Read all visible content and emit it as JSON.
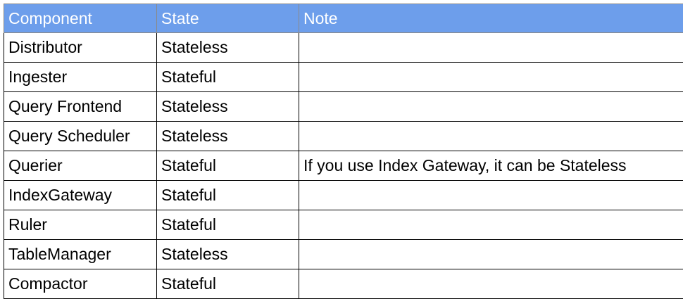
{
  "table": {
    "columns": [
      "Component",
      "State",
      "Note"
    ],
    "rows": [
      [
        "Distributor",
        "Stateless",
        ""
      ],
      [
        "Ingester",
        "Stateful",
        ""
      ],
      [
        "Query Frontend",
        "Stateless",
        ""
      ],
      [
        "Query Scheduler",
        "Stateless",
        ""
      ],
      [
        "Querier",
        "Stateful",
        "If you use Index Gateway, it can be Stateless"
      ],
      [
        "IndexGateway",
        "Stateful",
        ""
      ],
      [
        "Ruler",
        "Stateful",
        ""
      ],
      [
        "TableManager",
        "Stateless",
        ""
      ],
      [
        "Compactor",
        "Stateful",
        ""
      ]
    ]
  },
  "colors": {
    "header_bg": "#6d9eeb",
    "header_text": "#ffffff",
    "grid": "#000000"
  }
}
